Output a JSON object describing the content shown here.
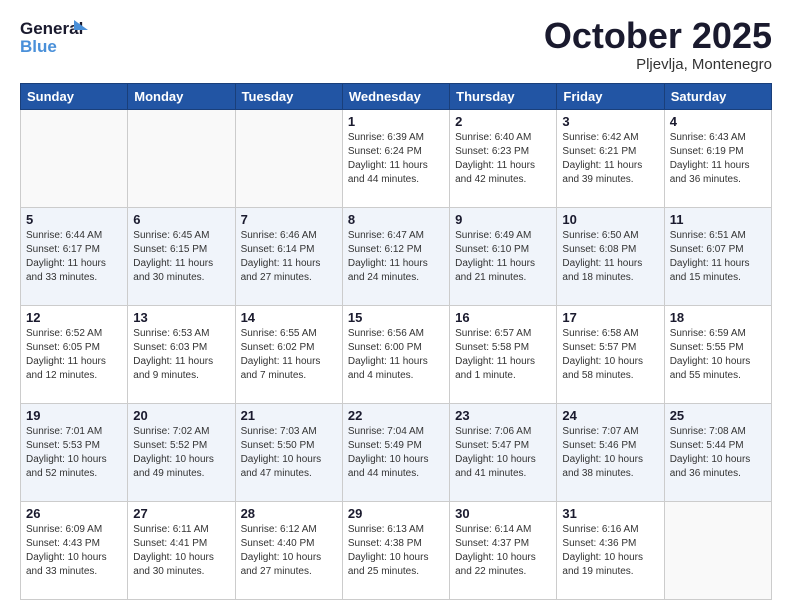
{
  "header": {
    "logo_general": "General",
    "logo_blue": "Blue",
    "month_title": "October 2025",
    "location": "Pljevlja, Montenegro"
  },
  "weekdays": [
    "Sunday",
    "Monday",
    "Tuesday",
    "Wednesday",
    "Thursday",
    "Friday",
    "Saturday"
  ],
  "weeks": [
    [
      {
        "day": "",
        "info": ""
      },
      {
        "day": "",
        "info": ""
      },
      {
        "day": "",
        "info": ""
      },
      {
        "day": "1",
        "info": "Sunrise: 6:39 AM\nSunset: 6:24 PM\nDaylight: 11 hours\nand 44 minutes."
      },
      {
        "day": "2",
        "info": "Sunrise: 6:40 AM\nSunset: 6:23 PM\nDaylight: 11 hours\nand 42 minutes."
      },
      {
        "day": "3",
        "info": "Sunrise: 6:42 AM\nSunset: 6:21 PM\nDaylight: 11 hours\nand 39 minutes."
      },
      {
        "day": "4",
        "info": "Sunrise: 6:43 AM\nSunset: 6:19 PM\nDaylight: 11 hours\nand 36 minutes."
      }
    ],
    [
      {
        "day": "5",
        "info": "Sunrise: 6:44 AM\nSunset: 6:17 PM\nDaylight: 11 hours\nand 33 minutes."
      },
      {
        "day": "6",
        "info": "Sunrise: 6:45 AM\nSunset: 6:15 PM\nDaylight: 11 hours\nand 30 minutes."
      },
      {
        "day": "7",
        "info": "Sunrise: 6:46 AM\nSunset: 6:14 PM\nDaylight: 11 hours\nand 27 minutes."
      },
      {
        "day": "8",
        "info": "Sunrise: 6:47 AM\nSunset: 6:12 PM\nDaylight: 11 hours\nand 24 minutes."
      },
      {
        "day": "9",
        "info": "Sunrise: 6:49 AM\nSunset: 6:10 PM\nDaylight: 11 hours\nand 21 minutes."
      },
      {
        "day": "10",
        "info": "Sunrise: 6:50 AM\nSunset: 6:08 PM\nDaylight: 11 hours\nand 18 minutes."
      },
      {
        "day": "11",
        "info": "Sunrise: 6:51 AM\nSunset: 6:07 PM\nDaylight: 11 hours\nand 15 minutes."
      }
    ],
    [
      {
        "day": "12",
        "info": "Sunrise: 6:52 AM\nSunset: 6:05 PM\nDaylight: 11 hours\nand 12 minutes."
      },
      {
        "day": "13",
        "info": "Sunrise: 6:53 AM\nSunset: 6:03 PM\nDaylight: 11 hours\nand 9 minutes."
      },
      {
        "day": "14",
        "info": "Sunrise: 6:55 AM\nSunset: 6:02 PM\nDaylight: 11 hours\nand 7 minutes."
      },
      {
        "day": "15",
        "info": "Sunrise: 6:56 AM\nSunset: 6:00 PM\nDaylight: 11 hours\nand 4 minutes."
      },
      {
        "day": "16",
        "info": "Sunrise: 6:57 AM\nSunset: 5:58 PM\nDaylight: 11 hours\nand 1 minute."
      },
      {
        "day": "17",
        "info": "Sunrise: 6:58 AM\nSunset: 5:57 PM\nDaylight: 10 hours\nand 58 minutes."
      },
      {
        "day": "18",
        "info": "Sunrise: 6:59 AM\nSunset: 5:55 PM\nDaylight: 10 hours\nand 55 minutes."
      }
    ],
    [
      {
        "day": "19",
        "info": "Sunrise: 7:01 AM\nSunset: 5:53 PM\nDaylight: 10 hours\nand 52 minutes."
      },
      {
        "day": "20",
        "info": "Sunrise: 7:02 AM\nSunset: 5:52 PM\nDaylight: 10 hours\nand 49 minutes."
      },
      {
        "day": "21",
        "info": "Sunrise: 7:03 AM\nSunset: 5:50 PM\nDaylight: 10 hours\nand 47 minutes."
      },
      {
        "day": "22",
        "info": "Sunrise: 7:04 AM\nSunset: 5:49 PM\nDaylight: 10 hours\nand 44 minutes."
      },
      {
        "day": "23",
        "info": "Sunrise: 7:06 AM\nSunset: 5:47 PM\nDaylight: 10 hours\nand 41 minutes."
      },
      {
        "day": "24",
        "info": "Sunrise: 7:07 AM\nSunset: 5:46 PM\nDaylight: 10 hours\nand 38 minutes."
      },
      {
        "day": "25",
        "info": "Sunrise: 7:08 AM\nSunset: 5:44 PM\nDaylight: 10 hours\nand 36 minutes."
      }
    ],
    [
      {
        "day": "26",
        "info": "Sunrise: 6:09 AM\nSunset: 4:43 PM\nDaylight: 10 hours\nand 33 minutes."
      },
      {
        "day": "27",
        "info": "Sunrise: 6:11 AM\nSunset: 4:41 PM\nDaylight: 10 hours\nand 30 minutes."
      },
      {
        "day": "28",
        "info": "Sunrise: 6:12 AM\nSunset: 4:40 PM\nDaylight: 10 hours\nand 27 minutes."
      },
      {
        "day": "29",
        "info": "Sunrise: 6:13 AM\nSunset: 4:38 PM\nDaylight: 10 hours\nand 25 minutes."
      },
      {
        "day": "30",
        "info": "Sunrise: 6:14 AM\nSunset: 4:37 PM\nDaylight: 10 hours\nand 22 minutes."
      },
      {
        "day": "31",
        "info": "Sunrise: 6:16 AM\nSunset: 4:36 PM\nDaylight: 10 hours\nand 19 minutes."
      },
      {
        "day": "",
        "info": ""
      }
    ]
  ]
}
